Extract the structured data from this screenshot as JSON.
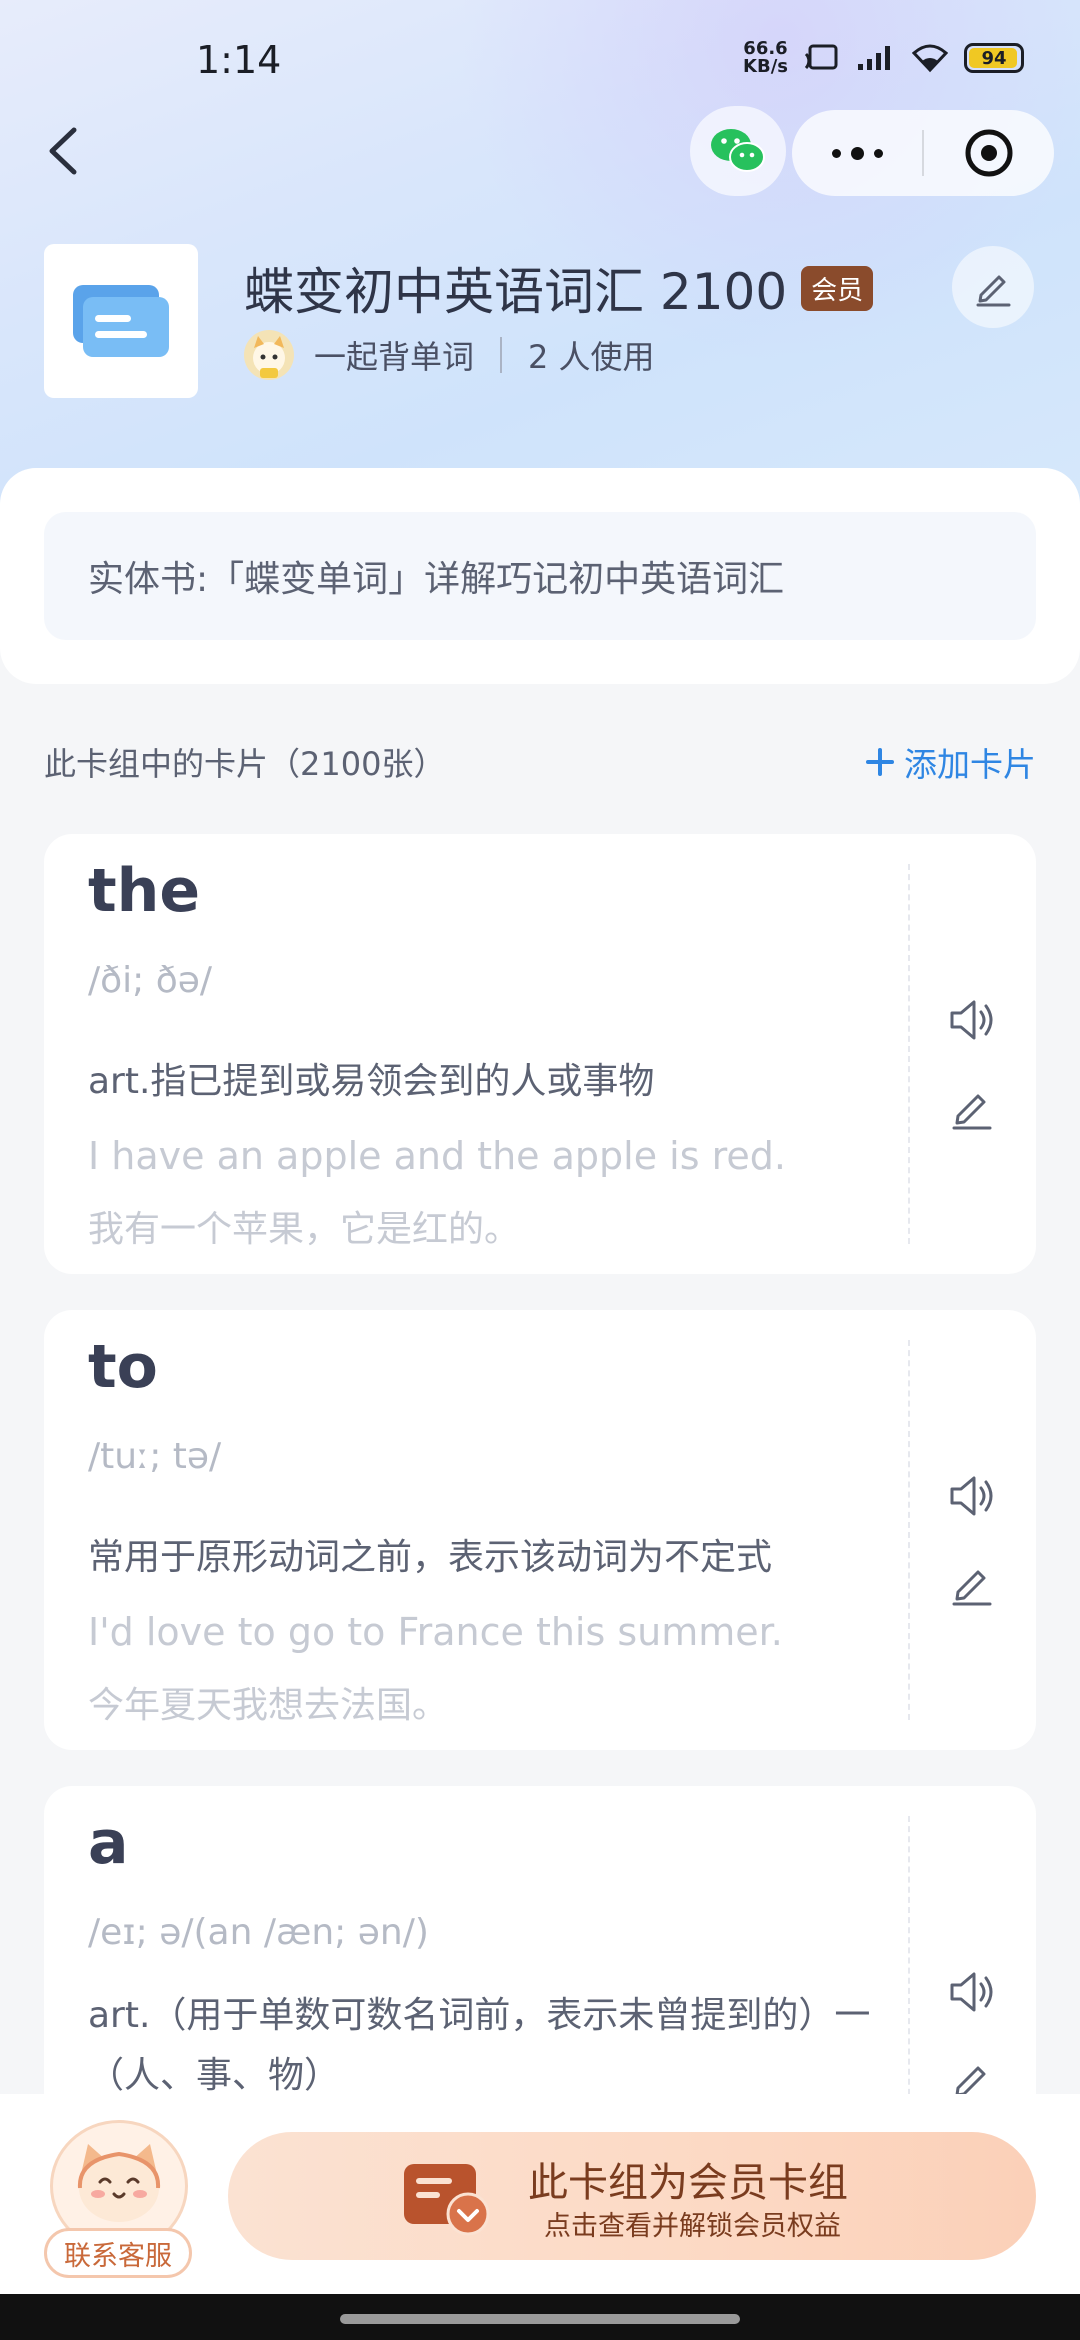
{
  "status_bar": {
    "time": "1:14",
    "net_speed": "66.6",
    "net_unit": "KB/s",
    "battery": "94"
  },
  "deck": {
    "title": "蝶变初中英语词汇 2100",
    "badge": "会员",
    "author": "一起背单词",
    "users": "2 人使用",
    "description": "实体书:「蝶变单词」详解巧记初中英语词汇"
  },
  "list": {
    "title": "此卡组中的卡片（2100张）",
    "add_label": "添加卡片"
  },
  "cards": [
    {
      "word": "the",
      "phonetic": "/ði; ðə/",
      "definition": "art.指已提到或易领会到的人或事物",
      "example_en": "I have an apple and the apple is red.",
      "example_zh": "我有一个苹果，它是红的。"
    },
    {
      "word": "to",
      "phonetic": "/tuː; tə/",
      "definition": "常用于原形动词之前，表示该动词为不定式",
      "example_en": "I'd love to go to France this summer.",
      "example_zh": "今年夏天我想去法国。"
    },
    {
      "word": "a",
      "phonetic": "/eɪ; ə/(an /æn; ən/)",
      "definition": "art.（用于单数可数名词前，表示未曾提到的）一（人、事、物）"
    }
  ],
  "bottom": {
    "service_label": "联系客服",
    "cta_title": "此卡组为会员卡组",
    "cta_subtitle": "点击查看并解锁会员权益"
  },
  "colors": {
    "accent": "#2f86e3",
    "badge": "#8a4b2c",
    "cta_text": "#7a3c1f"
  }
}
